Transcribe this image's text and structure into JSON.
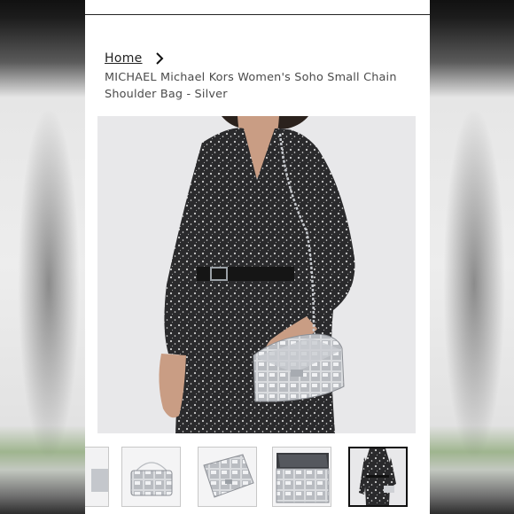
{
  "breadcrumb": {
    "home_label": "Home"
  },
  "product": {
    "title": "MICHAEL Michael Kors Women's Soho Small Chain Shoulder Bag - Silver"
  },
  "gallery": {
    "thumbnails": [
      {
        "label": "partial-thumbnail"
      },
      {
        "label": "bag-front"
      },
      {
        "label": "bag-angle"
      },
      {
        "label": "bag-top"
      },
      {
        "label": "model-worn"
      }
    ],
    "selected_index": 4
  },
  "colors": {
    "background": "#ffffff",
    "text": "#222222",
    "title_text": "#4a4a4a",
    "image_bg": "#e9e9ea",
    "selected_border": "#111111"
  },
  "icons": {
    "breadcrumb_separator": "chevron-right-icon"
  }
}
